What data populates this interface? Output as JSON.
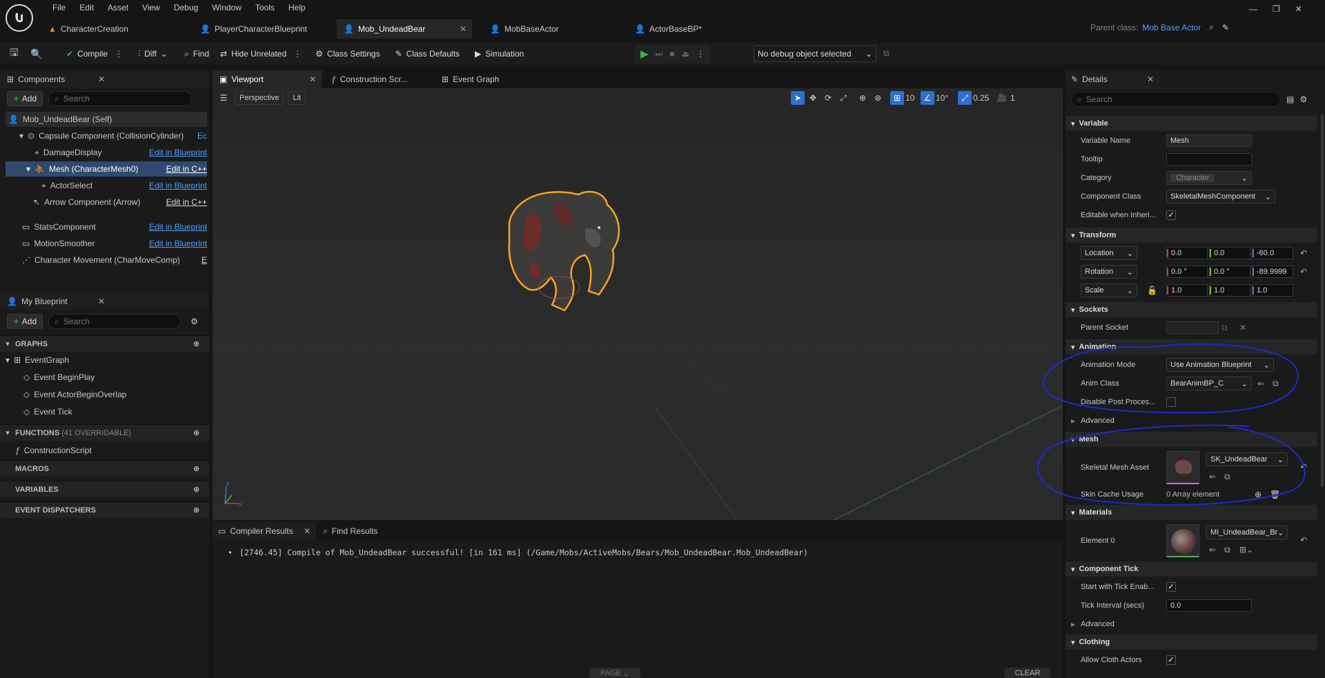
{
  "menu": [
    "File",
    "Edit",
    "Asset",
    "View",
    "Debug",
    "Window",
    "Tools",
    "Help"
  ],
  "doc_tabs": [
    {
      "label": "CharacterCreation"
    },
    {
      "label": "PlayerCharacterBlueprint"
    },
    {
      "label": "Mob_UndeadBear"
    },
    {
      "label": "MobBaseActor"
    },
    {
      "label": "ActorBaseBP*"
    }
  ],
  "parent_class": {
    "label": "Parent class:",
    "value": "Mob Base Actor"
  },
  "toolbar": {
    "compile": "Compile",
    "diff": "Diff",
    "find": "Find",
    "hide_unrelated": "Hide Unrelated",
    "class_settings": "Class Settings",
    "class_defaults": "Class Defaults",
    "simulation": "Simulation",
    "debug_object": "No debug object selected"
  },
  "components": {
    "title": "Components",
    "add": "Add",
    "search_placeholder": "Search",
    "items": [
      {
        "label": "Mob_UndeadBear (Self)",
        "action": ""
      },
      {
        "label": "Capsule Component (CollisionCylinder)",
        "action": "Ec"
      },
      {
        "label": "DamageDisplay",
        "action": "Edit in Blueprint"
      },
      {
        "label": "Mesh (CharacterMesh0)",
        "action": "Edit in C++"
      },
      {
        "label": "ActorSelect",
        "action": "Edit in Blueprint"
      },
      {
        "label": "Arrow Component (Arrow)",
        "action": "Edit in C++"
      },
      {
        "label": "StatsComponent",
        "action": "Edit in Blueprint"
      },
      {
        "label": "MotionSmoother",
        "action": "Edit in Blueprint"
      },
      {
        "label": "Character Movement (CharMoveComp)",
        "action": "E"
      }
    ]
  },
  "my_blueprint": {
    "title": "My Blueprint",
    "add": "Add",
    "search_placeholder": "Search",
    "graphs_label": "GRAPHS",
    "event_graph": "EventGraph",
    "events": [
      "Event BeginPlay",
      "Event ActorBeginOverlap",
      "Event Tick"
    ],
    "functions_label": "FUNCTIONS",
    "functions_note": "(41 OVERRIDABLE)",
    "construction_script": "ConstructionScript",
    "macros_label": "MACROS",
    "variables_label": "VARIABLES",
    "dispatchers_label": "EVENT DISPATCHERS"
  },
  "editor_tabs": [
    "Viewport",
    "Construction Scr...",
    "Event Graph"
  ],
  "viewport": {
    "perspective": "Perspective",
    "lit": "Lit",
    "grid": "10",
    "rotation": "10°",
    "scale": "0.25",
    "camera": "1"
  },
  "bottom": {
    "tabs": [
      "Compiler Results",
      "Find Results"
    ],
    "message": "[2746.45] Compile of Mob_UndeadBear successful! [in 161 ms] (/Game/Mobs/ActiveMobs/Bears/Mob_UndeadBear.Mob_UndeadBear)",
    "page": "PAGE",
    "clear": "CLEAR"
  },
  "details": {
    "title": "Details",
    "search_placeholder": "Search",
    "variable": {
      "section": "Variable",
      "name_label": "Variable Name",
      "name": "Mesh",
      "tooltip_label": "Tooltip",
      "category_label": "Category",
      "category": "Character",
      "class_label": "Component Class",
      "class": "SkeletalMeshComponent",
      "editable_label": "Editable when Inheri..."
    },
    "transform": {
      "section": "Transform",
      "location": "Location",
      "rotation": "Rotation",
      "scale": "Scale",
      "loc": [
        "0.0",
        "0.0",
        "-60.0"
      ],
      "rot": [
        "0.0 °",
        "0.0 °",
        "-89.9999"
      ],
      "scl": [
        "1.0",
        "1.0",
        "1.0"
      ]
    },
    "sockets": {
      "section": "Sockets",
      "parent_label": "Parent Socket"
    },
    "animation": {
      "section": "Animation",
      "mode_label": "Animation Mode",
      "mode": "Use Animation Blueprint",
      "class_label": "Anim Class",
      "class": "BearAnimBP_C",
      "disable_label": "Disable Post Proces...",
      "advanced": "Advanced"
    },
    "mesh": {
      "section": "Mesh",
      "asset_label": "Skeletal Mesh Asset",
      "asset": "SK_UndeadBear",
      "skin_label": "Skin Cache Usage",
      "skin": "0 Array element"
    },
    "materials": {
      "section": "Materials",
      "element_label": "Element 0",
      "element": "MI_UndeadBear_Br"
    },
    "tick": {
      "section": "Component Tick",
      "start_label": "Start with Tick Enab...",
      "interval_label": "Tick Interval (secs)",
      "interval": "0.0",
      "advanced": "Advanced"
    },
    "clothing": {
      "section": "Clothing",
      "allow_label": "Allow Cloth Actors"
    }
  },
  "colors": {
    "accent": "#4ba3ff",
    "selection": "#2f4a6e",
    "play": "#3cba3c",
    "annotation": "#1e2cc8",
    "outline": "#f5a623"
  }
}
